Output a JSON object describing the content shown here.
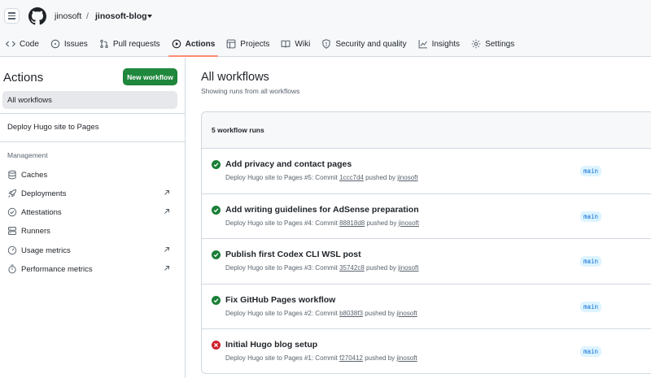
{
  "header": {
    "owner": "jinosoft",
    "separator": "/",
    "repo": "jinosoft-blog"
  },
  "tabs": [
    {
      "label": "Code",
      "icon": "code-icon"
    },
    {
      "label": "Issues",
      "icon": "issue-icon"
    },
    {
      "label": "Pull requests",
      "icon": "pull-request-icon"
    },
    {
      "label": "Actions",
      "icon": "play-icon",
      "active": true
    },
    {
      "label": "Projects",
      "icon": "table-icon"
    },
    {
      "label": "Wiki",
      "icon": "book-icon"
    },
    {
      "label": "Security and quality",
      "icon": "shield-icon"
    },
    {
      "label": "Insights",
      "icon": "graph-icon"
    },
    {
      "label": "Settings",
      "icon": "gear-icon"
    }
  ],
  "sidebar": {
    "title": "Actions",
    "new_workflow": "New workflow",
    "all_workflows": "All workflows",
    "workflows": [
      "Deploy Hugo site to Pages"
    ],
    "management_heading": "Management",
    "management": [
      {
        "label": "Caches",
        "icon": "database-icon",
        "external": false
      },
      {
        "label": "Deployments",
        "icon": "rocket-icon",
        "external": true
      },
      {
        "label": "Attestations",
        "icon": "verified-icon",
        "external": true
      },
      {
        "label": "Runners",
        "icon": "server-icon",
        "external": false
      },
      {
        "label": "Usage metrics",
        "icon": "meter-icon",
        "external": true
      },
      {
        "label": "Performance metrics",
        "icon": "stopwatch-icon",
        "external": true
      }
    ]
  },
  "main": {
    "title": "All workflows",
    "subtitle": "Showing runs from all workflows",
    "runs_count": "5 workflow runs",
    "runs": [
      {
        "title": "Add privacy and contact pages",
        "meta_prefix": "Deploy Hugo site to Pages #5: Commit ",
        "commit": "1ccc7d4",
        "meta_mid": " pushed by ",
        "author": "jinosoft",
        "branch": "main",
        "status": "success"
      },
      {
        "title": "Add writing guidelines for AdSense preparation",
        "meta_prefix": "Deploy Hugo site to Pages #4: Commit ",
        "commit": "88818d8",
        "meta_mid": " pushed by ",
        "author": "jinosoft",
        "branch": "main",
        "status": "success"
      },
      {
        "title": "Publish first Codex CLI WSL post",
        "meta_prefix": "Deploy Hugo site to Pages #3: Commit ",
        "commit": "35742c8",
        "meta_mid": " pushed by ",
        "author": "jinosoft",
        "branch": "main",
        "status": "success"
      },
      {
        "title": "Fix GitHub Pages workflow",
        "meta_prefix": "Deploy Hugo site to Pages #2: Commit ",
        "commit": "b8038f3",
        "meta_mid": " pushed by ",
        "author": "jinosoft",
        "branch": "main",
        "status": "success"
      },
      {
        "title": "Initial Hugo blog setup",
        "meta_prefix": "Deploy Hugo site to Pages #1: Commit ",
        "commit": "f270412",
        "meta_mid": " pushed by ",
        "author": "jinosoft",
        "branch": "main",
        "status": "failure"
      }
    ]
  },
  "colors": {
    "success": "#1a7f37",
    "failure": "#cf222e",
    "primary_button": "#1f883d",
    "active_tab_underline": "#fd8c73",
    "branch_bg": "#ddf4ff",
    "branch_text": "#0969da"
  }
}
